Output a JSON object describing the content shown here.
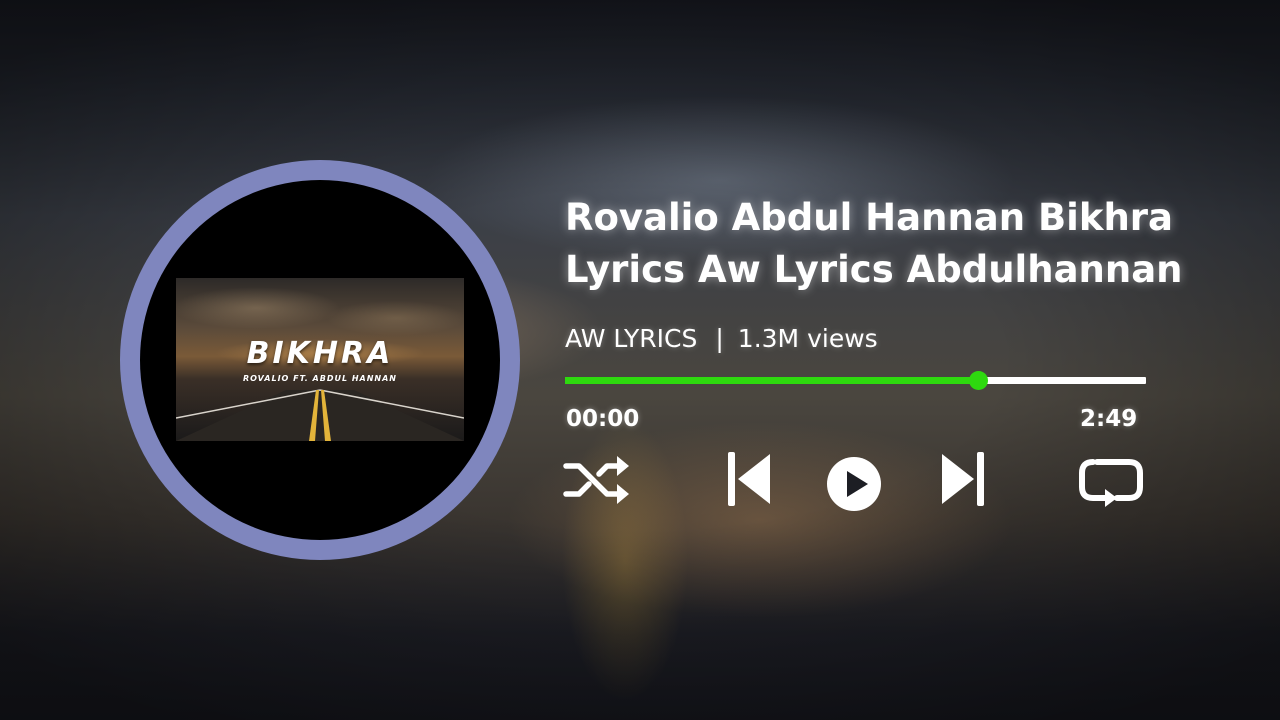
{
  "album_art": {
    "thumbnail_title": "BIKHRA",
    "thumbnail_subtitle": "ROVALIO FT. ABDUL HANNAN",
    "ring_color": "#7f86be"
  },
  "track": {
    "title_line1": "Rovalio Abdul Hannan Bikhra",
    "title_line2": "Lyrics Aw Lyrics Abdulhannan",
    "channel": "AW LYRICS",
    "separator": "|",
    "views": "1.3M views"
  },
  "progress": {
    "current_time": "00:00",
    "total_time": "2:49",
    "played_fraction": 0.71,
    "played_color": "#2ed90f",
    "remaining_color": "#ffffff"
  },
  "controls": {
    "icons": [
      "shuffle-icon",
      "previous-icon",
      "play-icon",
      "next-icon",
      "repeat-icon"
    ]
  }
}
